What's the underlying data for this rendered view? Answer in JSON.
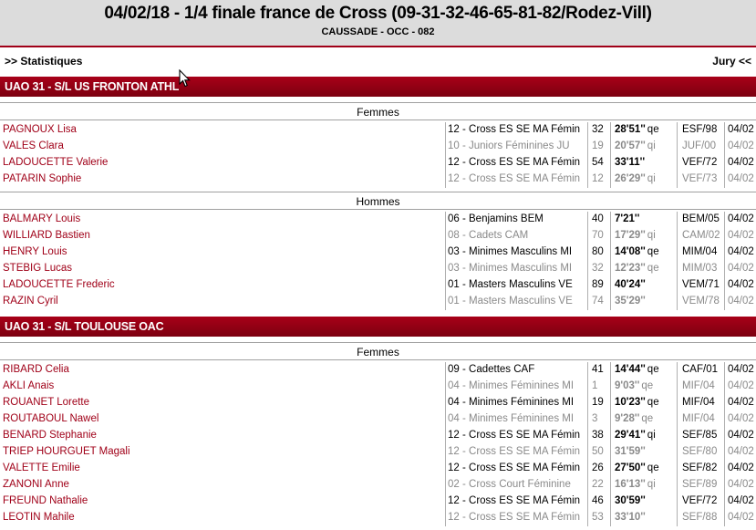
{
  "header": {
    "title": "04/02/18 - 1/4 finale france de Cross (09-31-32-46-65-81-82/Rodez-Vill)",
    "subtitle": "CAUSSADE - OCC - 082"
  },
  "toolbar": {
    "stats_label": ">> Statistiques",
    "jury_label": "Jury <<"
  },
  "clubs": [
    {
      "name": "UAO 31 - S/L US FRONTON ATHL",
      "groups": [
        {
          "label": "Femmes",
          "rows": [
            {
              "name": "PAGNOUX Lisa",
              "race": "12 - Cross ES SE MA Fémin",
              "pos": "32",
              "time": "28'51''",
              "q": "qe",
              "cat": "ESF/98",
              "date": "04/02"
            },
            {
              "name": "VALES Clara",
              "race": "10 - Juniors Féminines JU",
              "pos": "19",
              "time": "20'57''",
              "q": "qi",
              "cat": "JUF/00",
              "date": "04/02"
            },
            {
              "name": "LADOUCETTE Valerie",
              "race": "12 - Cross ES SE MA Fémin",
              "pos": "54",
              "time": "33'11''",
              "q": "",
              "cat": "VEF/72",
              "date": "04/02"
            },
            {
              "name": "PATARIN Sophie",
              "race": "12 - Cross ES SE MA Fémin",
              "pos": "12",
              "time": "26'29''",
              "q": "qi",
              "cat": "VEF/73",
              "date": "04/02"
            }
          ]
        },
        {
          "label": "Hommes",
          "rows": [
            {
              "name": "BALMARY Louis",
              "race": "06 - Benjamins BEM",
              "pos": "40",
              "time": "7'21''",
              "q": "",
              "cat": "BEM/05",
              "date": "04/02"
            },
            {
              "name": "WILLIARD Bastien",
              "race": "08 - Cadets CAM",
              "pos": "70",
              "time": "17'29''",
              "q": "qi",
              "cat": "CAM/02",
              "date": "04/02"
            },
            {
              "name": "HENRY Louis",
              "race": "03 - Minimes Masculins MI",
              "pos": "80",
              "time": "14'08''",
              "q": "qe",
              "cat": "MIM/04",
              "date": "04/02"
            },
            {
              "name": "STEBIG Lucas",
              "race": "03 - Minimes Masculins MI",
              "pos": "32",
              "time": "12'23''",
              "q": "qe",
              "cat": "MIM/03",
              "date": "04/02"
            },
            {
              "name": "LADOUCETTE Frederic",
              "race": "01 - Masters Masculins VE",
              "pos": "89",
              "time": "40'24''",
              "q": "",
              "cat": "VEM/71",
              "date": "04/02"
            },
            {
              "name": "RAZIN Cyril",
              "race": "01 - Masters Masculins VE",
              "pos": "74",
              "time": "35'29''",
              "q": "",
              "cat": "VEM/78",
              "date": "04/02"
            }
          ]
        }
      ]
    },
    {
      "name": "UAO 31 - S/L TOULOUSE OAC",
      "groups": [
        {
          "label": "Femmes",
          "rows": [
            {
              "name": "RIBARD Celia",
              "race": "09 - Cadettes CAF",
              "pos": "41",
              "time": "14'44''",
              "q": "qe",
              "cat": "CAF/01",
              "date": "04/02"
            },
            {
              "name": "AKLI Anais",
              "race": "04 - Minimes Féminines MI",
              "pos": "1",
              "time": "9'03''",
              "q": "qe",
              "cat": "MIF/04",
              "date": "04/02"
            },
            {
              "name": "ROUANET Lorette",
              "race": "04 - Minimes Féminines MI",
              "pos": "19",
              "time": "10'23''",
              "q": "qe",
              "cat": "MIF/04",
              "date": "04/02"
            },
            {
              "name": "ROUTABOUL Nawel",
              "race": "04 - Minimes Féminines MI",
              "pos": "3",
              "time": "9'28''",
              "q": "qe",
              "cat": "MIF/04",
              "date": "04/02"
            },
            {
              "name": "BENARD Stephanie",
              "race": "12 - Cross ES SE MA Fémin",
              "pos": "38",
              "time": "29'41''",
              "q": "qi",
              "cat": "SEF/85",
              "date": "04/02"
            },
            {
              "name": "TRIEP HOURGUET Magali",
              "race": "12 - Cross ES SE MA Fémin",
              "pos": "50",
              "time": "31'59''",
              "q": "",
              "cat": "SEF/80",
              "date": "04/02"
            },
            {
              "name": "VALETTE Emilie",
              "race": "12 - Cross ES SE MA Fémin",
              "pos": "26",
              "time": "27'50''",
              "q": "qe",
              "cat": "SEF/82",
              "date": "04/02"
            },
            {
              "name": "ZANONI Anne",
              "race": "02 - Cross Court Féminine",
              "pos": "22",
              "time": "16'13''",
              "q": "qi",
              "cat": "SEF/89",
              "date": "04/02"
            },
            {
              "name": "FREUND Nathalie",
              "race": "12 - Cross ES SE MA Fémin",
              "pos": "46",
              "time": "30'59''",
              "q": "",
              "cat": "VEF/72",
              "date": "04/02"
            },
            {
              "name": "LEOTIN Mahile",
              "race": "12 - Cross ES SE MA Fémin",
              "pos": "53",
              "time": "33'10''",
              "q": "",
              "cat": "SEF/88",
              "date": "04/02"
            }
          ]
        }
      ]
    }
  ],
  "colors": {
    "accent": "#a00018",
    "header_bg": "#dcdcdc",
    "muted": "#8a8a8a"
  }
}
